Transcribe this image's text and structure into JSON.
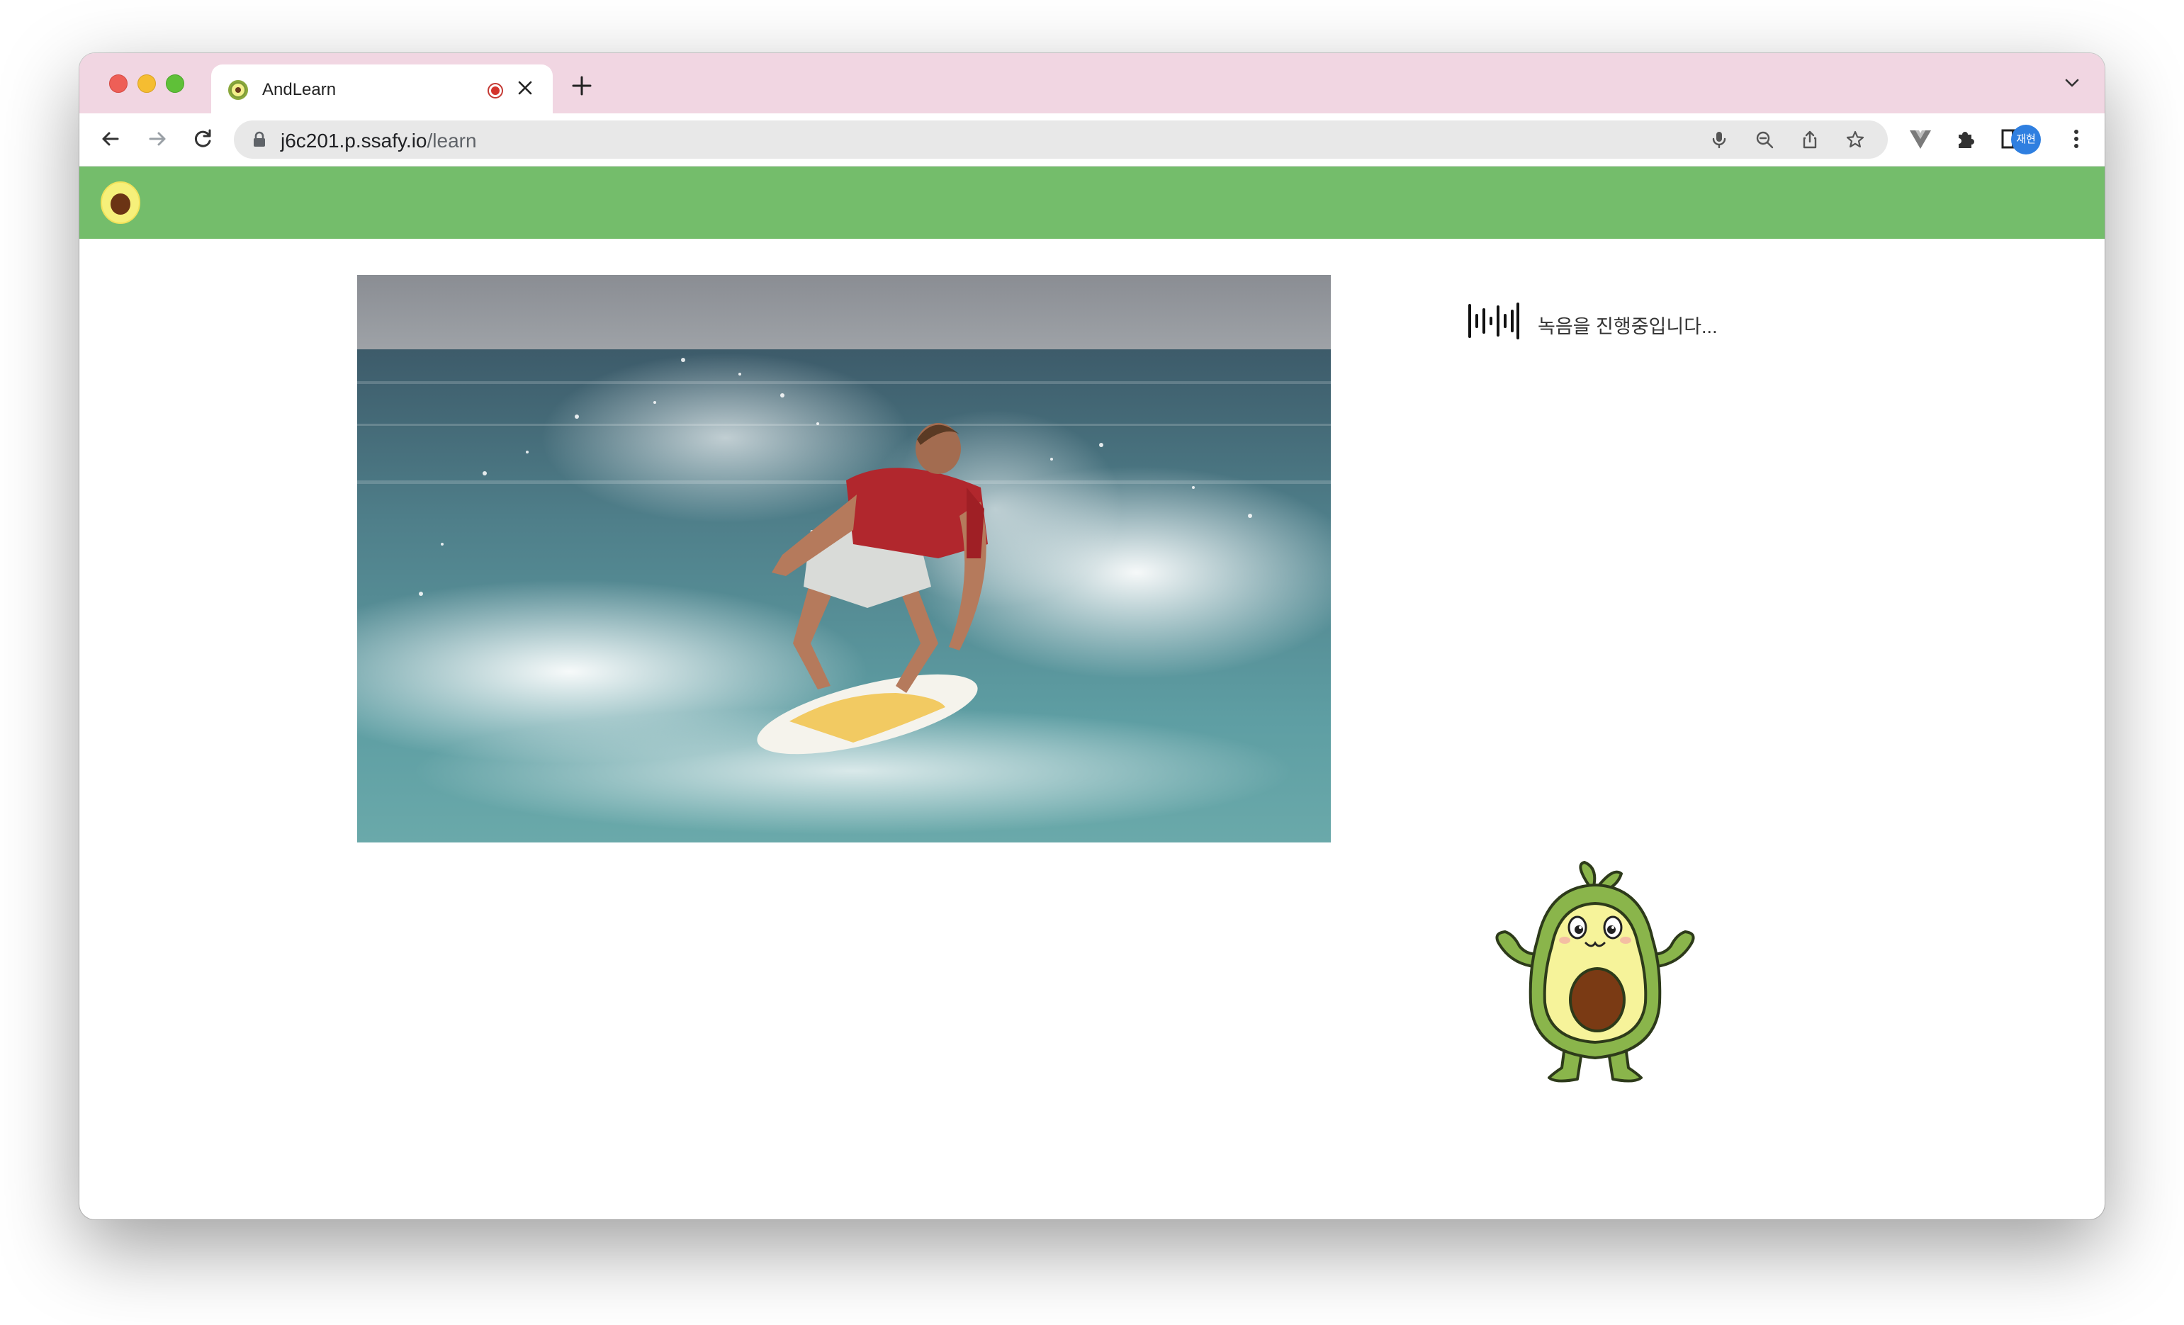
{
  "browser": {
    "tab": {
      "title": "AndLearn",
      "recording_indicator": "recording-icon",
      "close_icon": "close-icon"
    },
    "new_tab_icon": "plus-icon",
    "tab_list_icon": "chevron-down-icon",
    "nav": {
      "back_icon": "back-arrow-icon",
      "forward_icon": "forward-arrow-icon",
      "reload_icon": "reload-icon"
    },
    "address": {
      "host": "j6c201.p.ssafy.io",
      "path": "/learn",
      "lock_icon": "lock-icon"
    },
    "omnibox_icons": [
      "microphone-icon",
      "zoom-out-icon",
      "share-icon",
      "star-icon"
    ],
    "toolbar_icons": [
      "vue-devtools-icon",
      "extensions-puzzle-icon",
      "side-panel-icon",
      "more-vertical-icon"
    ],
    "profile": {
      "label": "재현"
    }
  },
  "app": {
    "header_color": "#74bd6b",
    "logo_icon": "avocado-logo-icon",
    "photo_subject": "surfer riding a wave",
    "recording": {
      "icon": "sound-wave-icon",
      "status_text": "녹음을 진행중입니다..."
    },
    "mascot": "avocado-mascot-illustration"
  },
  "colors": {
    "tab_strip": "#f1d6e2",
    "accent_green": "#74bd6b",
    "avatar_blue": "#2f7fe0",
    "record_red": "#d4342c"
  }
}
